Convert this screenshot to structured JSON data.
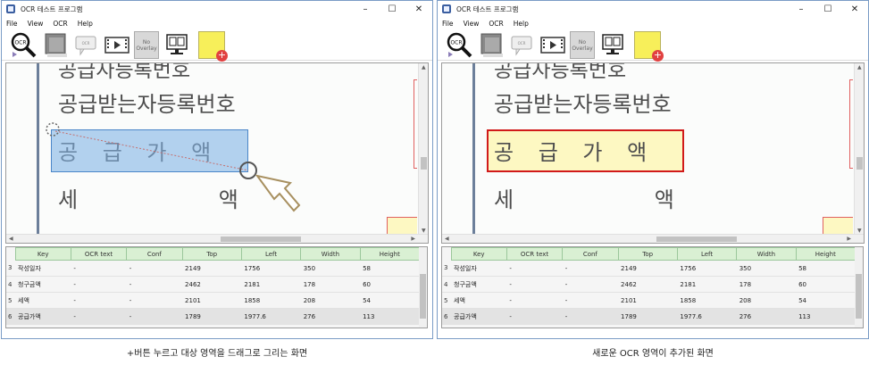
{
  "window_title": "OCR 테스트 프로그램",
  "menu": [
    "File",
    "View",
    "OCR",
    "Help"
  ],
  "toolbar": {
    "ocr_icon_label": "OCR",
    "no_overlay_label": "No Overlay",
    "image_btn_label": "",
    "text_btn_label": "",
    "video_btn_label": ""
  },
  "document": {
    "top_partial_line": "공급자등록번호",
    "line1": "공급받는자등록번호",
    "line2": "공 급 가 액",
    "line3": "세 액"
  },
  "grid": {
    "columns": [
      "Key",
      "OCR text",
      "Conf",
      "Top",
      "Left",
      "Width",
      "Height"
    ],
    "rows": [
      {
        "num": "3",
        "key": "작성일자",
        "ocr": "-",
        "conf": "-",
        "top": "2149",
        "left": "1756",
        "width": "350",
        "height": "58"
      },
      {
        "num": "4",
        "key": "청구금액",
        "ocr": "-",
        "conf": "-",
        "top": "2462",
        "left": "2181",
        "width": "178",
        "height": "60"
      },
      {
        "num": "5",
        "key": "세액",
        "ocr": "-",
        "conf": "-",
        "top": "2101",
        "left": "1858",
        "width": "208",
        "height": "54"
      },
      {
        "num": "6",
        "key": "공급가액",
        "ocr": "-",
        "conf": "-",
        "top": "1789",
        "left": "1977.6",
        "width": "276",
        "height": "113"
      }
    ]
  },
  "captions": {
    "left": "+버튼 누르고 대상 영역을 드래그로 그리는 화면",
    "right": "새로운 OCR 영역이 추가된 화면"
  },
  "colors": {
    "selection_fill": "#9cc2e8",
    "selection_border": "#4a86c8",
    "region_border": "#d11a1a",
    "region_fill": "#fdf8c2",
    "header_green": "#d9f0d3",
    "add_button_yellow": "#f7ef5a"
  }
}
